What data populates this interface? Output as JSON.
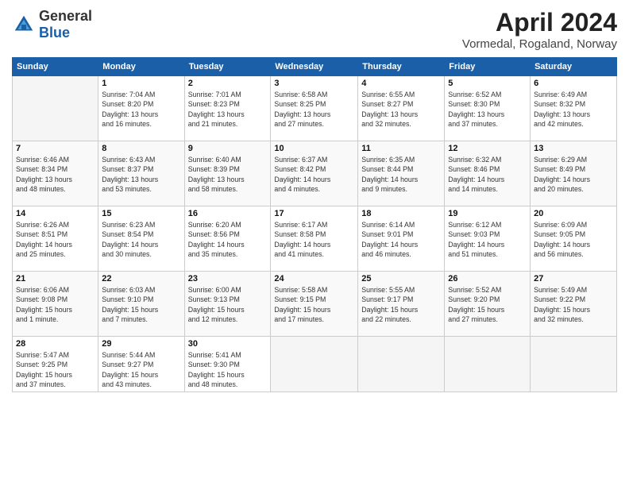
{
  "header": {
    "logo_general": "General",
    "logo_blue": "Blue",
    "month_title": "April 2024",
    "location": "Vormedal, Rogaland, Norway"
  },
  "days_of_week": [
    "Sunday",
    "Monday",
    "Tuesday",
    "Wednesday",
    "Thursday",
    "Friday",
    "Saturday"
  ],
  "weeks": [
    [
      {
        "day": "",
        "info": ""
      },
      {
        "day": "1",
        "info": "Sunrise: 7:04 AM\nSunset: 8:20 PM\nDaylight: 13 hours\nand 16 minutes."
      },
      {
        "day": "2",
        "info": "Sunrise: 7:01 AM\nSunset: 8:23 PM\nDaylight: 13 hours\nand 21 minutes."
      },
      {
        "day": "3",
        "info": "Sunrise: 6:58 AM\nSunset: 8:25 PM\nDaylight: 13 hours\nand 27 minutes."
      },
      {
        "day": "4",
        "info": "Sunrise: 6:55 AM\nSunset: 8:27 PM\nDaylight: 13 hours\nand 32 minutes."
      },
      {
        "day": "5",
        "info": "Sunrise: 6:52 AM\nSunset: 8:30 PM\nDaylight: 13 hours\nand 37 minutes."
      },
      {
        "day": "6",
        "info": "Sunrise: 6:49 AM\nSunset: 8:32 PM\nDaylight: 13 hours\nand 42 minutes."
      }
    ],
    [
      {
        "day": "7",
        "info": "Sunrise: 6:46 AM\nSunset: 8:34 PM\nDaylight: 13 hours\nand 48 minutes."
      },
      {
        "day": "8",
        "info": "Sunrise: 6:43 AM\nSunset: 8:37 PM\nDaylight: 13 hours\nand 53 minutes."
      },
      {
        "day": "9",
        "info": "Sunrise: 6:40 AM\nSunset: 8:39 PM\nDaylight: 13 hours\nand 58 minutes."
      },
      {
        "day": "10",
        "info": "Sunrise: 6:37 AM\nSunset: 8:42 PM\nDaylight: 14 hours\nand 4 minutes."
      },
      {
        "day": "11",
        "info": "Sunrise: 6:35 AM\nSunset: 8:44 PM\nDaylight: 14 hours\nand 9 minutes."
      },
      {
        "day": "12",
        "info": "Sunrise: 6:32 AM\nSunset: 8:46 PM\nDaylight: 14 hours\nand 14 minutes."
      },
      {
        "day": "13",
        "info": "Sunrise: 6:29 AM\nSunset: 8:49 PM\nDaylight: 14 hours\nand 20 minutes."
      }
    ],
    [
      {
        "day": "14",
        "info": "Sunrise: 6:26 AM\nSunset: 8:51 PM\nDaylight: 14 hours\nand 25 minutes."
      },
      {
        "day": "15",
        "info": "Sunrise: 6:23 AM\nSunset: 8:54 PM\nDaylight: 14 hours\nand 30 minutes."
      },
      {
        "day": "16",
        "info": "Sunrise: 6:20 AM\nSunset: 8:56 PM\nDaylight: 14 hours\nand 35 minutes."
      },
      {
        "day": "17",
        "info": "Sunrise: 6:17 AM\nSunset: 8:58 PM\nDaylight: 14 hours\nand 41 minutes."
      },
      {
        "day": "18",
        "info": "Sunrise: 6:14 AM\nSunset: 9:01 PM\nDaylight: 14 hours\nand 46 minutes."
      },
      {
        "day": "19",
        "info": "Sunrise: 6:12 AM\nSunset: 9:03 PM\nDaylight: 14 hours\nand 51 minutes."
      },
      {
        "day": "20",
        "info": "Sunrise: 6:09 AM\nSunset: 9:05 PM\nDaylight: 14 hours\nand 56 minutes."
      }
    ],
    [
      {
        "day": "21",
        "info": "Sunrise: 6:06 AM\nSunset: 9:08 PM\nDaylight: 15 hours\nand 1 minute."
      },
      {
        "day": "22",
        "info": "Sunrise: 6:03 AM\nSunset: 9:10 PM\nDaylight: 15 hours\nand 7 minutes."
      },
      {
        "day": "23",
        "info": "Sunrise: 6:00 AM\nSunset: 9:13 PM\nDaylight: 15 hours\nand 12 minutes."
      },
      {
        "day": "24",
        "info": "Sunrise: 5:58 AM\nSunset: 9:15 PM\nDaylight: 15 hours\nand 17 minutes."
      },
      {
        "day": "25",
        "info": "Sunrise: 5:55 AM\nSunset: 9:17 PM\nDaylight: 15 hours\nand 22 minutes."
      },
      {
        "day": "26",
        "info": "Sunrise: 5:52 AM\nSunset: 9:20 PM\nDaylight: 15 hours\nand 27 minutes."
      },
      {
        "day": "27",
        "info": "Sunrise: 5:49 AM\nSunset: 9:22 PM\nDaylight: 15 hours\nand 32 minutes."
      }
    ],
    [
      {
        "day": "28",
        "info": "Sunrise: 5:47 AM\nSunset: 9:25 PM\nDaylight: 15 hours\nand 37 minutes."
      },
      {
        "day": "29",
        "info": "Sunrise: 5:44 AM\nSunset: 9:27 PM\nDaylight: 15 hours\nand 43 minutes."
      },
      {
        "day": "30",
        "info": "Sunrise: 5:41 AM\nSunset: 9:30 PM\nDaylight: 15 hours\nand 48 minutes."
      },
      {
        "day": "",
        "info": ""
      },
      {
        "day": "",
        "info": ""
      },
      {
        "day": "",
        "info": ""
      },
      {
        "day": "",
        "info": ""
      }
    ]
  ]
}
